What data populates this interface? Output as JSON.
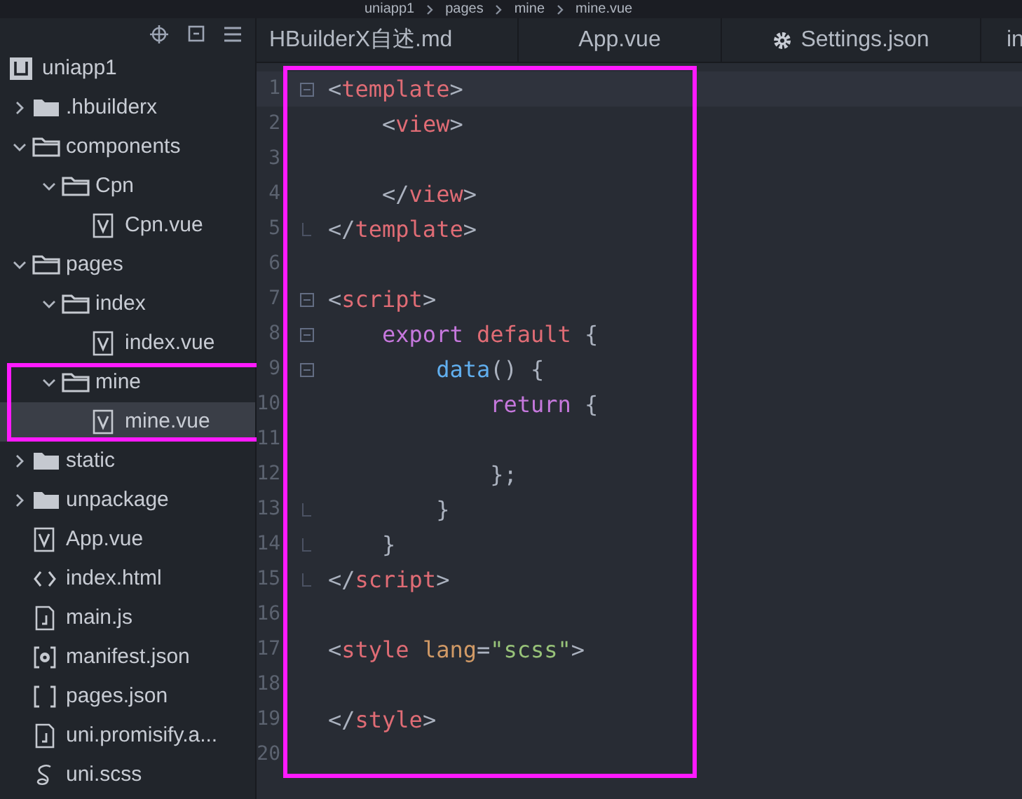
{
  "breadcrumb": [
    "uniapp1",
    "pages",
    "mine",
    "mine.vue"
  ],
  "sidebar": {
    "tree": [
      {
        "label": "uniapp1",
        "kind": "project",
        "selected": false,
        "highlighted": false,
        "children": [
          {
            "label": ".hbuilderx",
            "kind": "folder",
            "expanded": false,
            "selected": false,
            "highlighted": false
          },
          {
            "label": "components",
            "kind": "folder",
            "expanded": true,
            "selected": false,
            "highlighted": false,
            "children": [
              {
                "label": "Cpn",
                "kind": "folder",
                "expanded": true,
                "selected": false,
                "highlighted": false,
                "children": [
                  {
                    "label": "Cpn.vue",
                    "kind": "vue",
                    "selected": false,
                    "highlighted": false
                  }
                ]
              }
            ]
          },
          {
            "label": "pages",
            "kind": "folder",
            "expanded": true,
            "selected": false,
            "highlighted": false,
            "children": [
              {
                "label": "index",
                "kind": "folder",
                "expanded": true,
                "selected": false,
                "highlighted": false,
                "children": [
                  {
                    "label": "index.vue",
                    "kind": "vue",
                    "selected": false,
                    "highlighted": false
                  }
                ]
              },
              {
                "label": "mine",
                "kind": "folder",
                "expanded": true,
                "selected": false,
                "highlighted": true,
                "children": [
                  {
                    "label": "mine.vue",
                    "kind": "vue",
                    "selected": true,
                    "highlighted": false
                  }
                ]
              }
            ]
          },
          {
            "label": "static",
            "kind": "folder",
            "expanded": false,
            "selected": false,
            "highlighted": false
          },
          {
            "label": "unpackage",
            "kind": "folder",
            "expanded": false,
            "selected": false,
            "highlighted": false
          },
          {
            "label": "App.vue",
            "kind": "vue",
            "selected": false,
            "highlighted": false
          },
          {
            "label": "index.html",
            "kind": "html",
            "selected": false,
            "highlighted": false
          },
          {
            "label": "main.js",
            "kind": "js",
            "selected": false,
            "highlighted": false
          },
          {
            "label": "manifest.json",
            "kind": "config",
            "selected": false,
            "highlighted": false
          },
          {
            "label": "pages.json",
            "kind": "json",
            "selected": false,
            "highlighted": false
          },
          {
            "label": "uni.promisify.a...",
            "kind": "js",
            "selected": false,
            "highlighted": false
          },
          {
            "label": "uni.scss",
            "kind": "scss",
            "selected": false,
            "highlighted": false
          }
        ]
      }
    ]
  },
  "tabs": [
    {
      "label": "HBuilderX自述.md",
      "kind": "file",
      "selected": false
    },
    {
      "label": "App.vue",
      "kind": "file",
      "selected": false
    },
    {
      "label": "Settings.json",
      "kind": "settings",
      "selected": false
    },
    {
      "label": "in",
      "kind": "file",
      "selected": false
    }
  ],
  "editor": {
    "highlighted": true,
    "lines": [
      {
        "number": "1",
        "fold_start": true,
        "fold_end": false,
        "current": true,
        "tokens": [
          {
            "kind": "punct",
            "text": "<"
          },
          {
            "kind": "tag",
            "text": "template"
          },
          {
            "kind": "punct",
            "text": ">"
          }
        ]
      },
      {
        "number": "2",
        "fold_start": false,
        "fold_end": false,
        "current": false,
        "tokens": [
          {
            "kind": "punct",
            "text": "    <"
          },
          {
            "kind": "tag",
            "text": "view"
          },
          {
            "kind": "punct",
            "text": ">"
          }
        ]
      },
      {
        "number": "3",
        "fold_start": false,
        "fold_end": false,
        "current": false
      },
      {
        "number": "4",
        "fold_start": false,
        "fold_end": false,
        "current": false,
        "tokens": [
          {
            "kind": "punct",
            "text": "    </"
          },
          {
            "kind": "tag",
            "text": "view"
          },
          {
            "kind": "punct",
            "text": ">"
          }
        ]
      },
      {
        "number": "5",
        "fold_start": false,
        "fold_end": true,
        "current": false,
        "tokens": [
          {
            "kind": "punct",
            "text": "</"
          },
          {
            "kind": "tag",
            "text": "template"
          },
          {
            "kind": "punct",
            "text": ">"
          }
        ]
      },
      {
        "number": "6",
        "fold_start": false,
        "fold_end": false,
        "current": false
      },
      {
        "number": "7",
        "fold_start": true,
        "fold_end": false,
        "current": false,
        "tokens": [
          {
            "kind": "punct",
            "text": "<"
          },
          {
            "kind": "tag",
            "text": "script"
          },
          {
            "kind": "punct",
            "text": ">"
          }
        ]
      },
      {
        "number": "8",
        "fold_start": true,
        "fold_end": false,
        "current": false,
        "tokens": [
          {
            "kind": "keyword",
            "text": "    export"
          },
          {
            "kind": "tag",
            "text": " default"
          },
          {
            "kind": "punct",
            "text": " {"
          }
        ]
      },
      {
        "number": "9",
        "fold_start": true,
        "fold_end": false,
        "current": false,
        "tokens": [
          {
            "kind": "func",
            "text": "        data"
          },
          {
            "kind": "punct",
            "text": "() {"
          }
        ]
      },
      {
        "number": "10",
        "fold_start": false,
        "fold_end": false,
        "current": false,
        "tokens": [
          {
            "kind": "keyword",
            "text": "            return"
          },
          {
            "kind": "punct",
            "text": " {"
          }
        ]
      },
      {
        "number": "11",
        "fold_start": false,
        "fold_end": false,
        "current": false
      },
      {
        "number": "12",
        "fold_start": false,
        "fold_end": false,
        "current": false,
        "tokens": [
          {
            "kind": "punct",
            "text": "            };"
          }
        ]
      },
      {
        "number": "13",
        "fold_start": false,
        "fold_end": true,
        "current": false,
        "tokens": [
          {
            "kind": "punct",
            "text": "        }"
          }
        ]
      },
      {
        "number": "14",
        "fold_start": false,
        "fold_end": true,
        "current": false,
        "tokens": [
          {
            "kind": "punct",
            "text": "    }"
          }
        ]
      },
      {
        "number": "15",
        "fold_start": false,
        "fold_end": true,
        "current": false,
        "tokens": [
          {
            "kind": "punct",
            "text": "</"
          },
          {
            "kind": "tag",
            "text": "script"
          },
          {
            "kind": "punct",
            "text": ">"
          }
        ]
      },
      {
        "number": "16",
        "fold_start": false,
        "fold_end": false,
        "current": false
      },
      {
        "number": "17",
        "fold_start": false,
        "fold_end": false,
        "current": false,
        "tokens": [
          {
            "kind": "punct",
            "text": "<"
          },
          {
            "kind": "tag",
            "text": "style"
          },
          {
            "kind": "attr",
            "text": " lang"
          },
          {
            "kind": "punct",
            "text": "="
          },
          {
            "kind": "string",
            "text": "\"scss\""
          },
          {
            "kind": "punct",
            "text": ">"
          }
        ]
      },
      {
        "number": "18",
        "fold_start": false,
        "fold_end": false,
        "current": false
      },
      {
        "number": "19",
        "fold_start": false,
        "fold_end": false,
        "current": false,
        "tokens": [
          {
            "kind": "punct",
            "text": "</"
          },
          {
            "kind": "tag",
            "text": "style"
          },
          {
            "kind": "punct",
            "text": ">"
          }
        ]
      },
      {
        "number": "20",
        "fold_start": false,
        "fold_end": false,
        "current": false
      }
    ]
  }
}
